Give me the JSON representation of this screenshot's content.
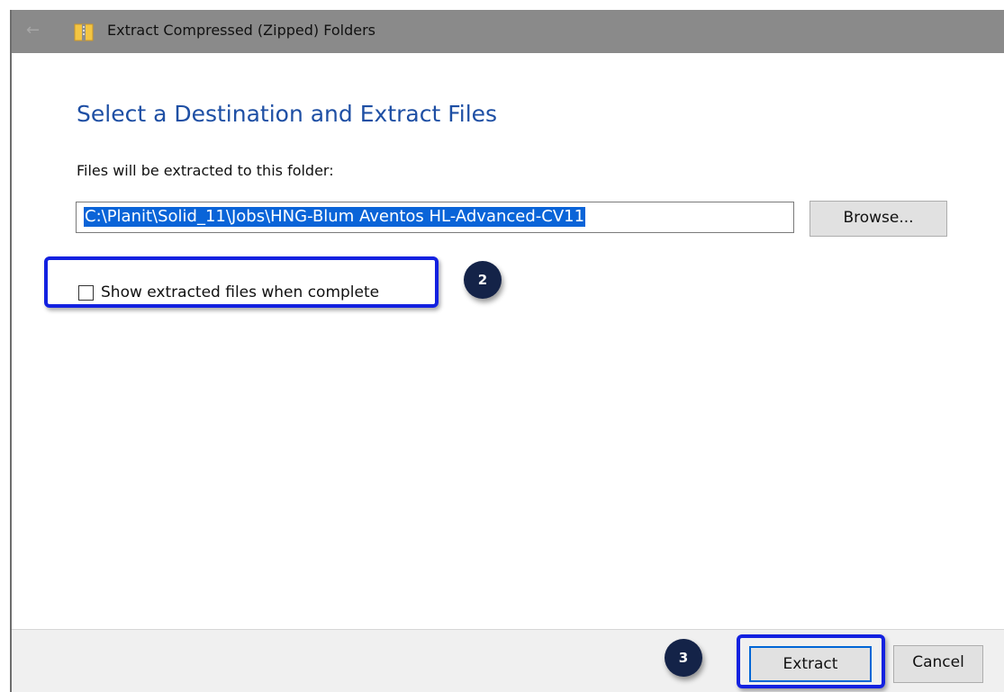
{
  "window": {
    "title": "Extract Compressed (Zipped) Folders",
    "back_icon": "arrow-left-icon",
    "app_icon": "zipped-folder-icon"
  },
  "main": {
    "heading": "Select a Destination and Extract Files",
    "field_label": "Files will be extracted to this folder:",
    "path_value": "C:\\Planit\\Solid_11\\Jobs\\HNG-Blum Aventos HL-Advanced-CV11",
    "browse_label": "Browse...",
    "show_files_label": "Show extracted files when complete",
    "show_files_checked": false
  },
  "footer": {
    "extract_label": "Extract",
    "cancel_label": "Cancel"
  },
  "annotations": {
    "step_2": "2",
    "step_3": "3"
  },
  "colors": {
    "heading": "#1e4fa4",
    "selection": "#0a64d8",
    "annotation": "#1321e0",
    "badge": "#142348"
  }
}
